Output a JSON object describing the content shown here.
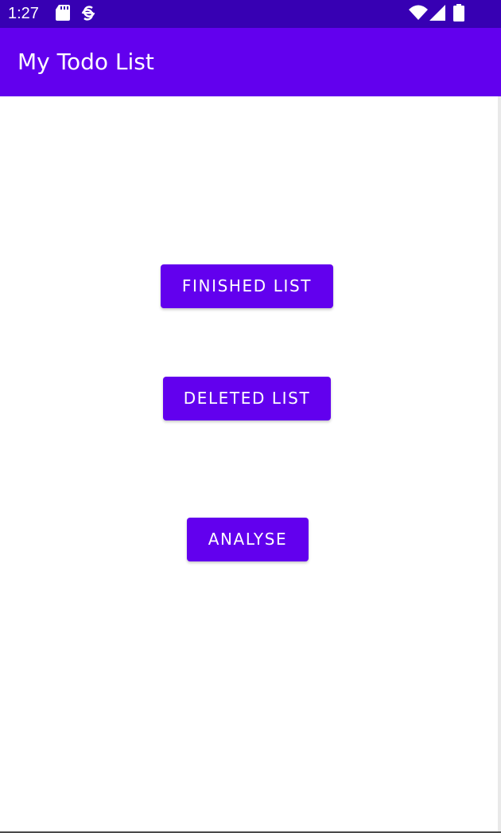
{
  "status_bar": {
    "time": "1:27",
    "icons": [
      "sd-card-icon",
      "sync-icon",
      "wifi-icon",
      "cellular-signal-icon",
      "battery-icon"
    ],
    "color": "#3700b3"
  },
  "app_bar": {
    "title": "My Todo List",
    "color": "#6200ee"
  },
  "buttons": {
    "finished_list": "FINISHED LIST",
    "deleted_list": "DELETED LIST",
    "analyse": "ANALYSE"
  },
  "colors": {
    "accent": "#6200ee",
    "accent_dark": "#3700b3",
    "background": "#ffffff"
  }
}
